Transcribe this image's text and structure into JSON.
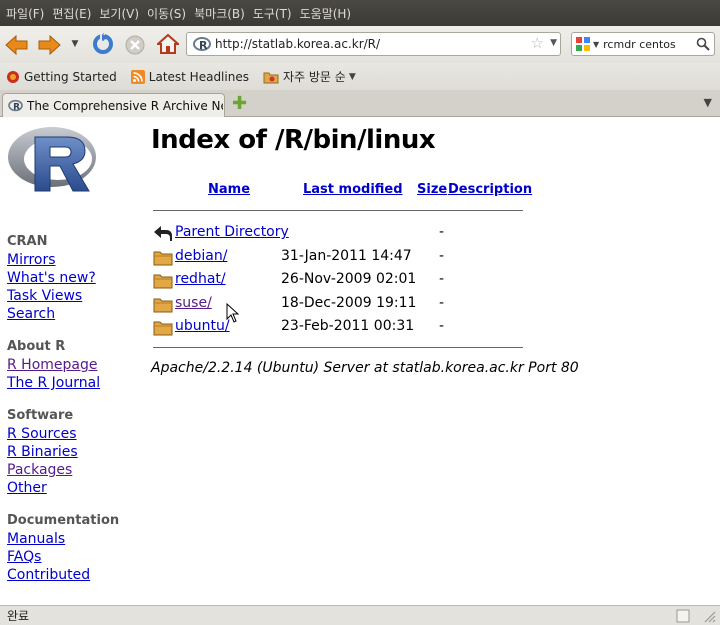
{
  "menu": [
    "파일(F)",
    "편집(E)",
    "보기(V)",
    "이동(S)",
    "북마크(B)",
    "도구(T)",
    "도움말(H)"
  ],
  "nav": {
    "url": "http://statlab.korea.ac.kr/R/",
    "search_text": "rcmdr centos"
  },
  "bookmarks": [
    {
      "label": "Getting Started",
      "icon": "firefox-icon"
    },
    {
      "label": "Latest Headlines",
      "icon": "rss-icon"
    },
    {
      "label": "자주 방문 순",
      "icon": "folder-star-icon"
    }
  ],
  "tab": {
    "title": "The Comprehensive R Archive Netw…"
  },
  "sidebar": {
    "groups": [
      {
        "heading": "CRAN",
        "links": [
          {
            "label": "Mirrors"
          },
          {
            "label": "What's new?"
          },
          {
            "label": "Task Views"
          },
          {
            "label": "Search"
          }
        ]
      },
      {
        "heading": "About R",
        "links": [
          {
            "label": "R Homepage"
          },
          {
            "label": "The R Journal"
          }
        ]
      },
      {
        "heading": "Software",
        "links": [
          {
            "label": "R Sources"
          },
          {
            "label": "R Binaries"
          },
          {
            "label": "Packages"
          },
          {
            "label": "Other"
          }
        ]
      },
      {
        "heading": "Documentation",
        "links": [
          {
            "label": "Manuals"
          },
          {
            "label": "FAQs"
          },
          {
            "label": "Contributed"
          }
        ]
      }
    ]
  },
  "main": {
    "title": "Index of /R/bin/linux",
    "columns": [
      "Name",
      "Last modified",
      "Size",
      "Description"
    ],
    "parent": {
      "name": "Parent Directory",
      "size": "-"
    },
    "rows": [
      {
        "name": "debian/",
        "modified": "31-Jan-2011 14:47",
        "size": "-"
      },
      {
        "name": "redhat/",
        "modified": "26-Nov-2009 02:01",
        "size": "-"
      },
      {
        "name": "suse/",
        "modified": "18-Dec-2009 19:11",
        "size": "-"
      },
      {
        "name": "ubuntu/",
        "modified": "23-Feb-2011 00:31",
        "size": "-"
      }
    ],
    "address": "Apache/2.2.14 (Ubuntu) Server at statlab.korea.ac.kr Port 80"
  },
  "status": "완료"
}
